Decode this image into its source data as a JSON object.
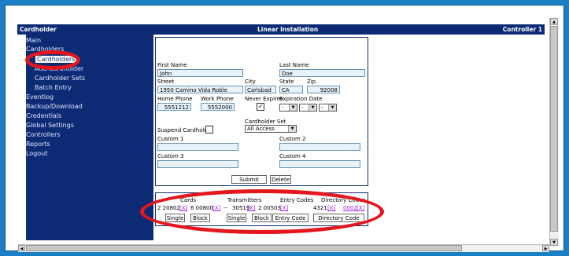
{
  "header": {
    "left": "Cardholder",
    "center": "Linear Installation",
    "right": "Controller 1"
  },
  "sidebar": {
    "items": [
      {
        "label": "Main",
        "sub": false,
        "selected": false
      },
      {
        "label": "Cardholders",
        "sub": false,
        "selected": false
      },
      {
        "label": "Cardholders",
        "sub": true,
        "selected": true
      },
      {
        "label": "Add Cardholder",
        "sub": true,
        "selected": false
      },
      {
        "label": "Cardholder Sets",
        "sub": true,
        "selected": false
      },
      {
        "label": "Batch Entry",
        "sub": true,
        "selected": false
      },
      {
        "label": "Eventlog",
        "sub": false,
        "selected": false
      },
      {
        "label": "Backup/Download",
        "sub": false,
        "selected": false
      },
      {
        "label": "Credentials",
        "sub": false,
        "selected": false
      },
      {
        "label": "Global Settings",
        "sub": false,
        "selected": false
      },
      {
        "label": "Controllers",
        "sub": false,
        "selected": false
      },
      {
        "label": "Reports",
        "sub": false,
        "selected": false
      },
      {
        "label": "Logout",
        "sub": false,
        "selected": false
      }
    ]
  },
  "form": {
    "first_name_label": "First Name",
    "first_name": "John",
    "last_name_label": "Last Name",
    "last_name": "Doe",
    "street_label": "Street",
    "street": "1950 Camino Vida Roble",
    "city_label": "City",
    "city": "Carlsbad",
    "state_label": "State",
    "state": "CA",
    "zip_label": "Zip",
    "zip": "92008",
    "home_phone_label": "Home Phone",
    "home_phone": "5551212",
    "work_phone_label": "Work Phone",
    "work_phone": "5552000",
    "never_expires_label": "Never Expires",
    "never_expires_mark": "✓",
    "expiration_label": "Expiration Date",
    "exp_placeholder": "-",
    "cardholder_set_label": "Cardholder Set",
    "cardholder_set": "All Access",
    "suspend_label": "Suspend Cardholder",
    "custom1_label": "Custom 1",
    "custom2_label": "Custom 2",
    "custom3_label": "Custom 3",
    "custom4_label": "Custom 4",
    "submit": "Submit",
    "delete": "Delete"
  },
  "credentials": {
    "cards_label": "Cards",
    "transmitters_label": "Transmitters",
    "entry_codes_label": "Entry Codes",
    "directory_codes_label": "Directory Codes",
    "card1": "2 20802",
    "card2": "6 00800",
    "sep": "--",
    "tx1": "30519",
    "tx2": "2 00503",
    "entry_code": "4321",
    "directory_code": "0002",
    "x": "[X]",
    "single": "Single",
    "block": "Block",
    "entry_code_btn": "Entry Code",
    "directory_code_btn": "Directory Code"
  },
  "colors": {
    "nav_bg": "#0d2b75",
    "outer_bg": "#1a80c4",
    "highlight": "#e3171d"
  }
}
